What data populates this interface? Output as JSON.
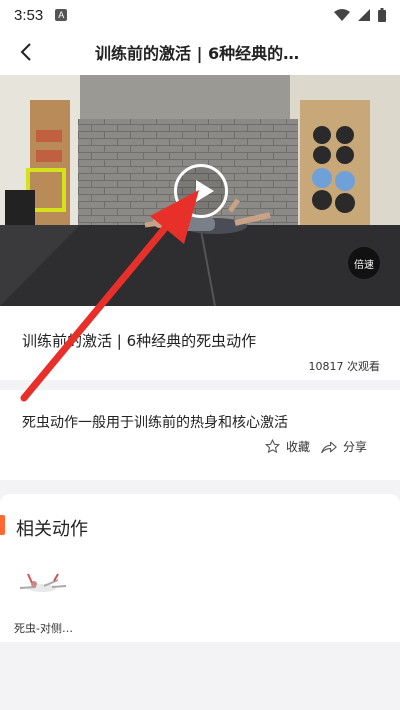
{
  "status": {
    "time": "3:53",
    "app_badge": "A"
  },
  "header": {
    "title": "训练前的激活 | 6种经典的…"
  },
  "video": {
    "speed_label": "倍速"
  },
  "exercise": {
    "title": "训练前的激活 | 6种经典的死虫动作",
    "views": "10817 次观看",
    "description": "死虫动作一般用于训练前的热身和核心激活"
  },
  "actions": {
    "favorite": "收藏",
    "share": "分享"
  },
  "related": {
    "title": "相关动作",
    "items": [
      {
        "name": "死虫-对侧…"
      }
    ]
  },
  "colors": {
    "accent": "#ff6a33",
    "arrow": "#e8302a"
  }
}
